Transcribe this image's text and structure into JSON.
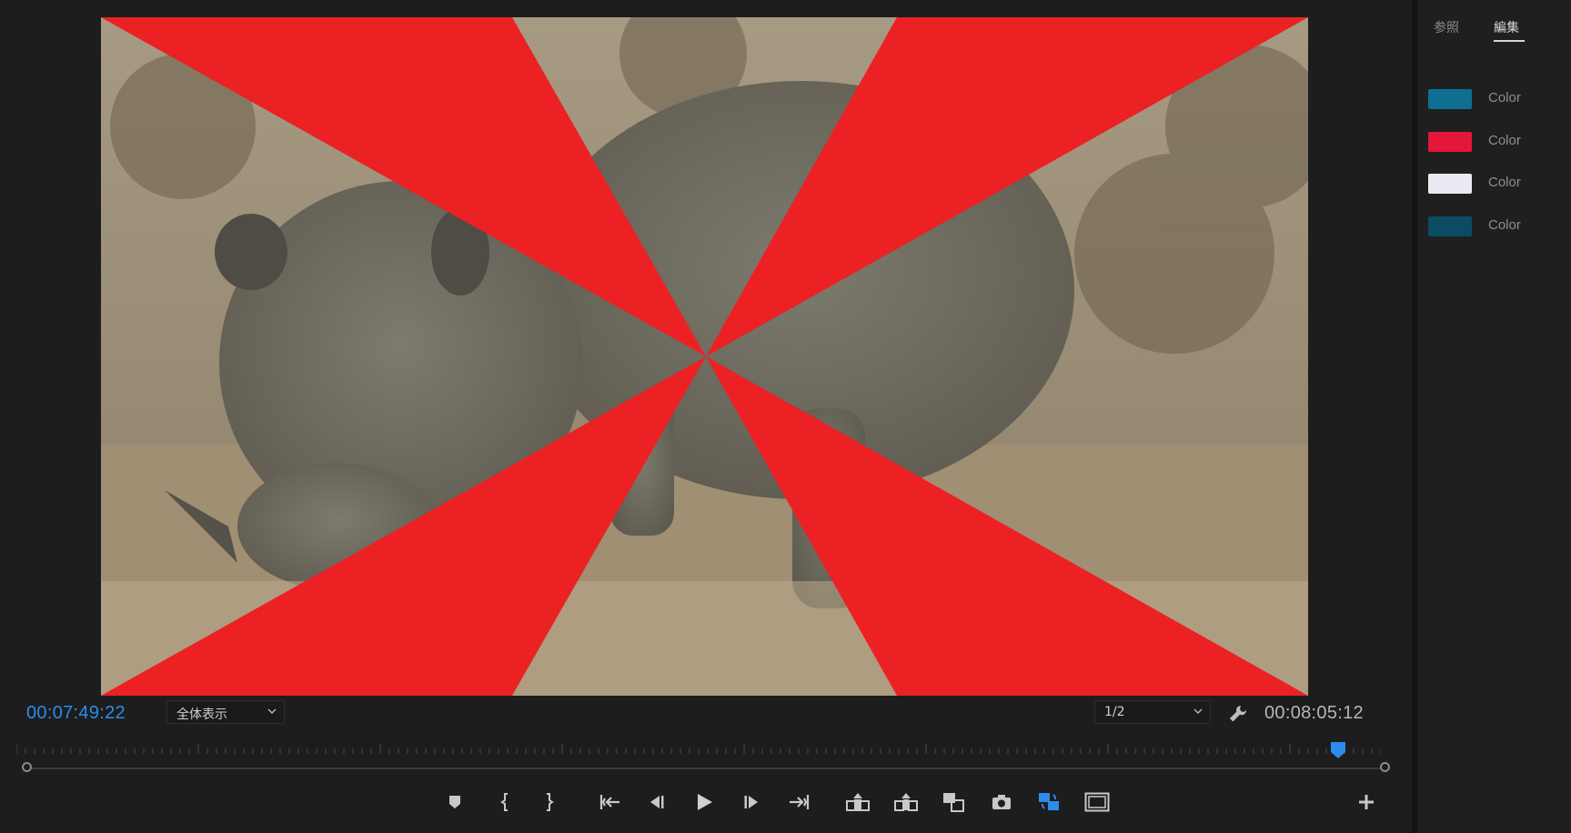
{
  "monitor": {
    "current_timecode": "00:07:49:22",
    "duration_timecode": "00:08:05:12",
    "zoom_select": "全体表示",
    "resolution_select": "1/2",
    "settings_icon": "wrench-icon",
    "progress_fraction": 0.967,
    "transport": [
      {
        "name": "add-marker-button",
        "icon": "marker-icon"
      },
      {
        "name": "mark-in-button",
        "icon": "mark-in-icon"
      },
      {
        "name": "mark-out-button",
        "icon": "mark-out-icon"
      },
      {
        "name": "go-to-in-button",
        "icon": "go-to-in-icon"
      },
      {
        "name": "step-back-button",
        "icon": "step-back-icon"
      },
      {
        "name": "play-button",
        "icon": "play-icon"
      },
      {
        "name": "step-forward-button",
        "icon": "step-forward-icon"
      },
      {
        "name": "go-to-out-button",
        "icon": "go-to-out-icon"
      },
      {
        "name": "lift-button",
        "icon": "lift-icon"
      },
      {
        "name": "extract-button",
        "icon": "extract-icon"
      },
      {
        "name": "insert-button",
        "icon": "insert-icon"
      },
      {
        "name": "export-frame-button",
        "icon": "camera-icon"
      },
      {
        "name": "comparison-view-button",
        "icon": "comparison-icon"
      },
      {
        "name": "safe-margins-button",
        "icon": "safe-margins-icon"
      },
      {
        "name": "add-button",
        "icon": "plus-icon"
      }
    ]
  },
  "panel": {
    "tabs": [
      {
        "label": "参照",
        "active": false
      },
      {
        "label": "編集",
        "active": true
      }
    ],
    "swatches": [
      {
        "label": "Color",
        "color": "#0f6f93"
      },
      {
        "label": "Color",
        "color": "#e4163a"
      },
      {
        "label": "Color",
        "color": "#ece8f2"
      },
      {
        "label": "Color",
        "color": "#0b4c63"
      }
    ]
  },
  "colors": {
    "accent": "#2d8ceb",
    "overlay": "#ec2124"
  }
}
